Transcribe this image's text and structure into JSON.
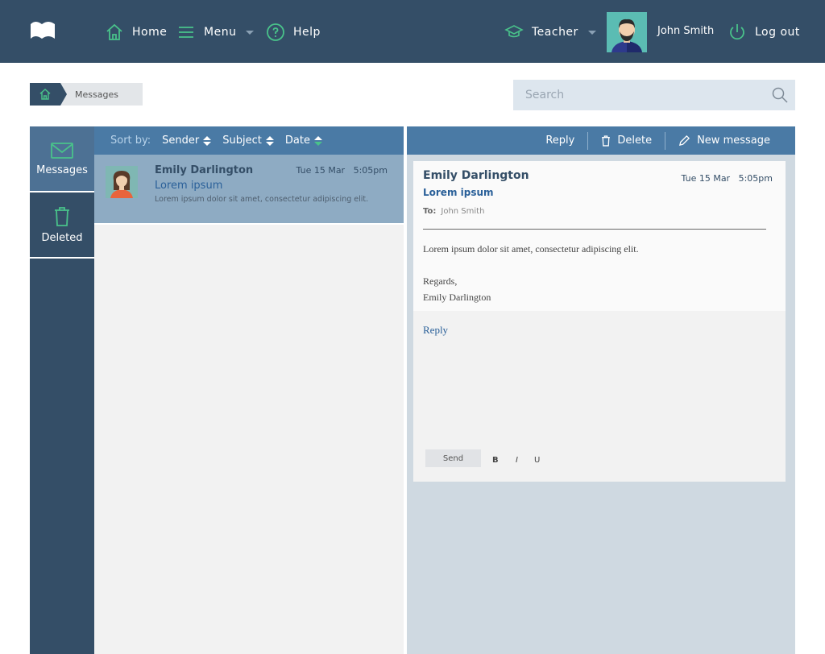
{
  "header": {
    "nav": {
      "home": "Home",
      "menu": "Menu",
      "help": "Help"
    },
    "role": "Teacher",
    "user_name": "John Smith",
    "logout": "Log out"
  },
  "breadcrumb": {
    "current": "Messages"
  },
  "search": {
    "placeholder": "Search"
  },
  "sidebar": {
    "items": [
      {
        "label": "Messages",
        "icon": "envelope-icon"
      },
      {
        "label": "Deleted",
        "icon": "trash-icon"
      }
    ]
  },
  "message_list": {
    "sort_label": "Sort by:",
    "sort_options": [
      "Sender",
      "Subject",
      "Date"
    ],
    "messages": [
      {
        "sender": "Emily Darlington",
        "date": "Tue 15 Mar",
        "time": "5:05pm",
        "subject": "Lorem ipsum",
        "preview": "Lorem ipsum dolor sit amet, consectetur adipiscing elit."
      }
    ]
  },
  "reader": {
    "toolbar": {
      "reply": "Reply",
      "delete": "Delete",
      "new_message": "New message"
    },
    "sender": "Emily Darlington",
    "date": "Tue 15 Mar",
    "time": "5:05pm",
    "subject": "Lorem ipsum",
    "to_label": "To:",
    "to_name": "John Smith",
    "body": "Lorem ipsum dolor sit amet, consectetur adipiscing elit.",
    "closing": "Regards,",
    "signature": "Emily Darlington",
    "reply_link": "Reply",
    "send": "Send",
    "format": {
      "bold": "B",
      "italic": "I",
      "underline": "U"
    }
  },
  "colors": {
    "header": "#344e67",
    "accent": "#49c28a",
    "bar": "#4a7aa5"
  }
}
